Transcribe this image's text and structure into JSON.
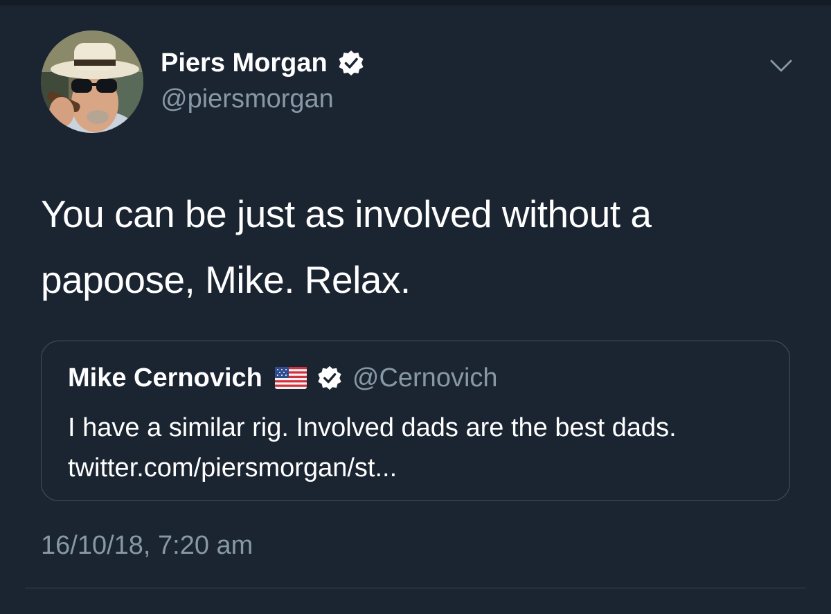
{
  "tweet": {
    "author": {
      "display_name": "Piers Morgan",
      "handle": "@piersmorgan",
      "verified": true,
      "avatar_icon": "profile-photo-man-in-panama-hat-with-sunglasses-and-cigar"
    },
    "text": "You can be just as involved without a papoose, Mike. Relax.",
    "timestamp": "16/10/18, 7:20 am",
    "menu_icon": "chevron-down-icon"
  },
  "quoted_tweet": {
    "display_name": "Mike Cernovich",
    "flag_icon": "us-flag-emoji",
    "verified": true,
    "handle": "@Cernovich",
    "text": "I have a similar rig. Involved dads are the best dads. twitter.com/piersmorgan/st..."
  },
  "colors": {
    "background": "#1b2532",
    "primary_text": "#ffffff",
    "secondary_text": "#8899a6",
    "card_border": "#3d5466"
  }
}
